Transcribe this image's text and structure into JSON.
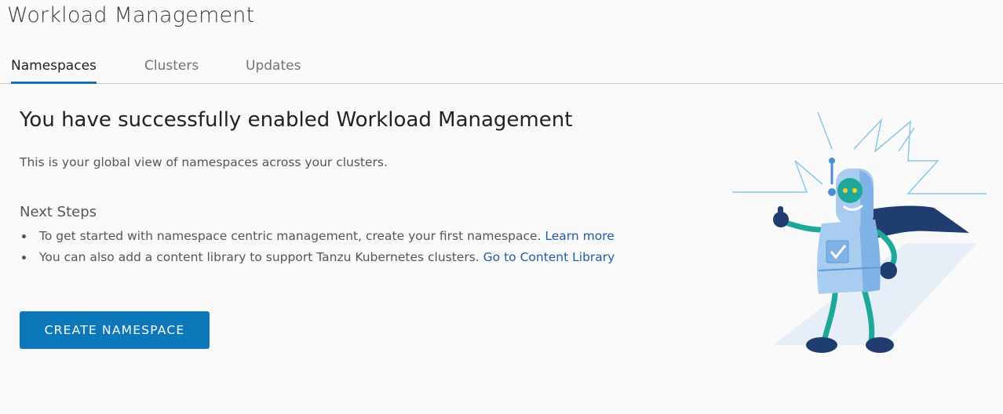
{
  "page": {
    "title": "Workload Management"
  },
  "tabs": [
    {
      "label": "Namespaces",
      "active": true
    },
    {
      "label": "Clusters",
      "active": false
    },
    {
      "label": "Updates",
      "active": false
    }
  ],
  "main": {
    "headline": "You have successfully enabled Workload Management",
    "subtext": "This is your global view of namespaces across your clusters.",
    "next_steps_title": "Next Steps",
    "steps": [
      {
        "text": "To get started with namespace centric management, create your first namespace. ",
        "link": "Learn more"
      },
      {
        "text": "You can also add a content library to support Tanzu Kubernetes clusters. ",
        "link": "Go to Content Library"
      }
    ],
    "create_button": "CREATE NAMESPACE"
  },
  "colors": {
    "accent": "#0c77b9",
    "tab_underline": "#1a6fb0",
    "link": "#1f5ca8"
  },
  "illustration": {
    "icon": "robot-thumbs-up-illustration"
  }
}
